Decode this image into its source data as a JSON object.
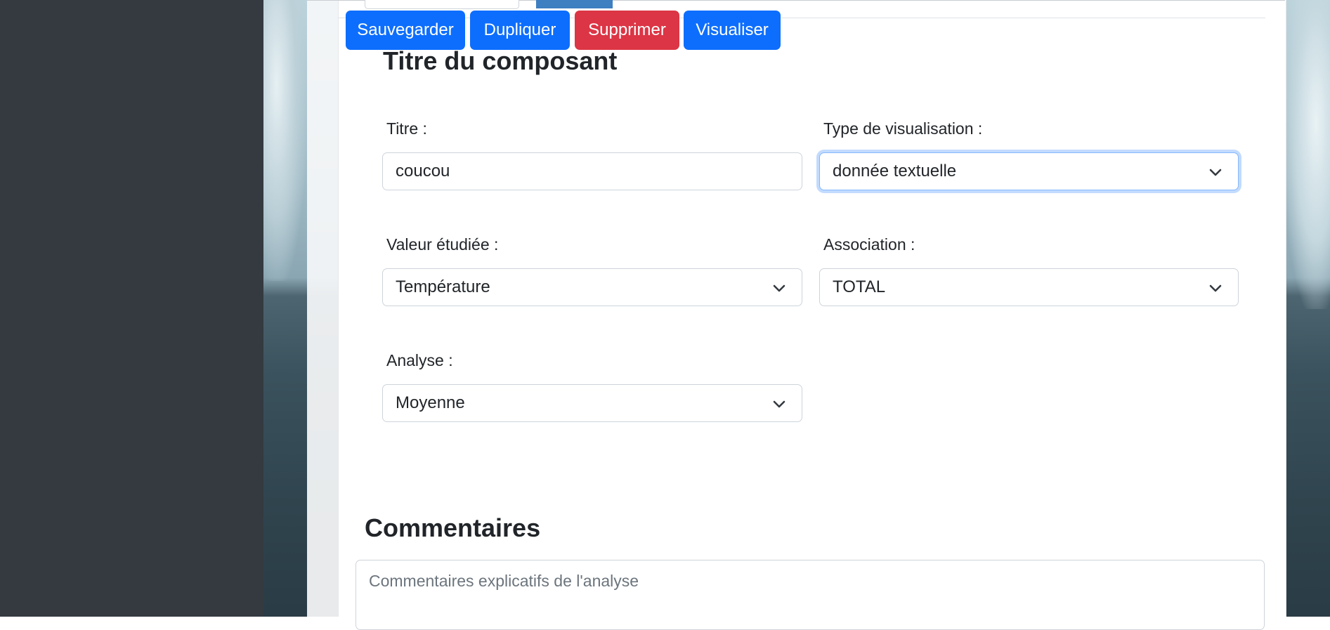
{
  "toolbar": {
    "save_label": "Sauvegarder",
    "duplicate_label": "Dupliquer",
    "delete_label": "Supprimer",
    "preview_label": "Visualiser"
  },
  "component": {
    "section_title": "Titre du composant",
    "title": {
      "label": "Titre :",
      "value": "coucou"
    },
    "visualization_type": {
      "label": "Type de visualisation :",
      "value": "donnée textuelle"
    },
    "studied_value": {
      "label": "Valeur étudiée :",
      "value": "Température"
    },
    "association": {
      "label": "Association :",
      "value": "TOTAL"
    },
    "analysis": {
      "label": "Analyse :",
      "value": "Moyenne"
    }
  },
  "comments": {
    "title": "Commentaires",
    "placeholder": "Commentaires explicatifs de l'analyse"
  },
  "colors": {
    "primary": "#0d6efd",
    "danger": "#dc3545",
    "sidebar": "#343a40",
    "focus_ring": "#86b7fe"
  },
  "icons": {
    "select_arrow": "chevron-down-icon"
  }
}
